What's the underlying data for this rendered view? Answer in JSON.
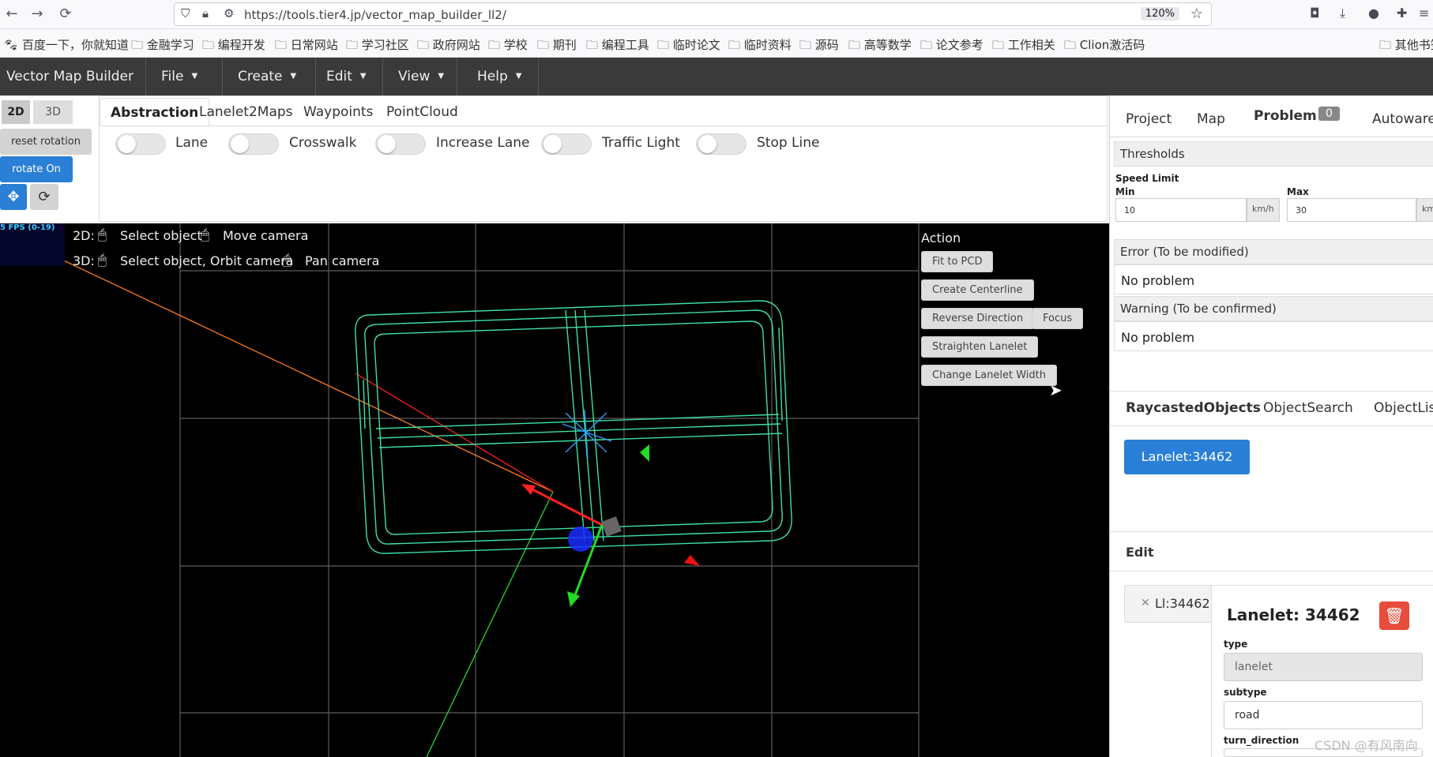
{
  "browser": {
    "url": "https://tools.tier4.jp/vector_map_builder_ll2/",
    "zoom": "120%",
    "bookmarks": [
      "百度一下，你就知道",
      "金融学习",
      "编程开发",
      "日常网站",
      "学习社区",
      "政府网站",
      "学校",
      "期刊",
      "编程工具",
      "临时论文",
      "临时资料",
      "源码",
      "高等数学",
      "论文参考",
      "工作相关",
      "Clion激活码",
      "其他书签"
    ]
  },
  "app_nav": {
    "brand": "Vector Map Builder",
    "menus": [
      "File",
      "Create",
      "Edit",
      "View",
      "Help"
    ]
  },
  "left_tools": {
    "mode_2d": "2D",
    "mode_3d": "3D",
    "reset_rotation": "reset rotation",
    "rotate_on": "rotate On"
  },
  "tabs": {
    "items": [
      "Abstraction",
      "Lanelet2Maps",
      "Waypoints",
      "PointCloud"
    ],
    "active": "Abstraction",
    "toggles": [
      "Lane",
      "Crosswalk",
      "Increase Lane",
      "Traffic Light",
      "Stop Line"
    ]
  },
  "viewport": {
    "fps": "5 FPS (0-19)",
    "hint_2d_prefix": "2D:",
    "hint_2d_select": "Select object",
    "hint_2d_move": "Move camera",
    "hint_3d_prefix": "3D:",
    "hint_3d_select": "Select object, Orbit camera",
    "hint_3d_pan": "Pan camera"
  },
  "action": {
    "title": "Action",
    "buttons": {
      "fit": "Fit to PCD",
      "centerline": "Create Centerline",
      "reverse": "Reverse Direction",
      "focus": "Focus",
      "straighten": "Straighten Lanelet",
      "width": "Change Lanelet Width"
    }
  },
  "right_panel": {
    "tabs": [
      "Project",
      "Map",
      "Problem",
      "Autoware"
    ],
    "problem_count": "0",
    "thresholds": "Thresholds",
    "speed_limit": "Speed Limit",
    "min_label": "Min",
    "max_label": "Max",
    "min_value": "10",
    "max_value": "30",
    "unit": "km/h",
    "unit_cut": "km",
    "error_header": "Error (To be modified)",
    "error_text": "No problem",
    "warning_header": "Warning (To be confirmed)",
    "warning_text": "No problem",
    "object_tabs": [
      "RaycastedObjects",
      "ObjectSearch",
      "ObjectList"
    ],
    "lanelet_button": "Lanelet:34462",
    "edit_title": "Edit",
    "edit_chip": "Ll:34462",
    "card_title": "Lanelet: 34462",
    "type_label": "type",
    "type_value": "lanelet",
    "subtype_label": "subtype",
    "subtype_value": "road",
    "turn_label": "turn_direction"
  },
  "watermark": "CSDN @有风南向",
  "colors": {
    "nav_bg": "#3a3a3a",
    "accent_blue": "#2a7fd6",
    "lane_green": "#3fe0a0",
    "delete_red": "#e74c3c"
  }
}
